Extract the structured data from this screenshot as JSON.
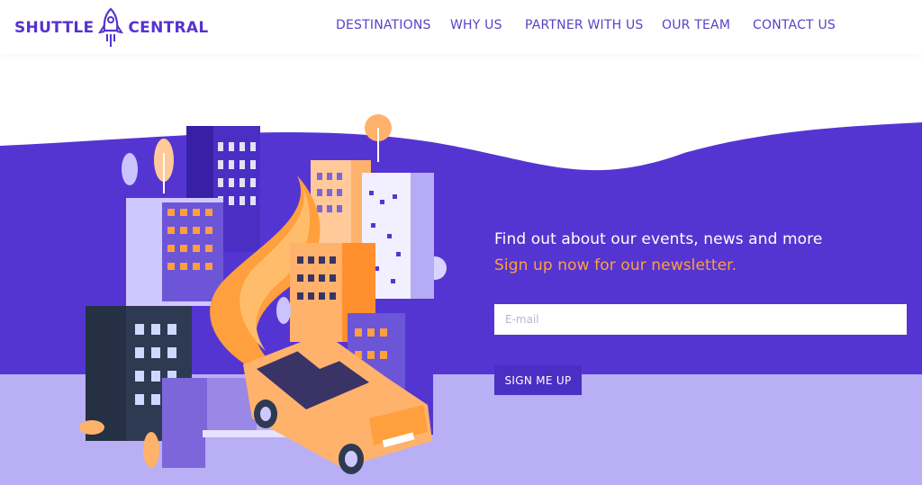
{
  "brand": {
    "word_left": "SHUTTLE",
    "word_right": "CENTRAL"
  },
  "nav": {
    "items": [
      {
        "label": "DESTINATIONS"
      },
      {
        "label": "WHY US"
      },
      {
        "label": "PARTNER WITH US"
      },
      {
        "label": "OUR TEAM"
      },
      {
        "label": "CONTACT US"
      }
    ]
  },
  "newsletter": {
    "heading": "Find out about our events, news and more",
    "subheading": "Sign up now for our newsletter.",
    "email_placeholder": "E-mail",
    "email_value": "",
    "button_label": "SIGN ME UP"
  },
  "colors": {
    "brand_purple": "#5433d0",
    "hero_purple": "#5535d2",
    "ground_lavender": "#b8aff5",
    "accent_orange": "#ff9f3d",
    "button_purple": "#4a2fc4"
  },
  "icons": {
    "logo": "rocket-icon"
  }
}
